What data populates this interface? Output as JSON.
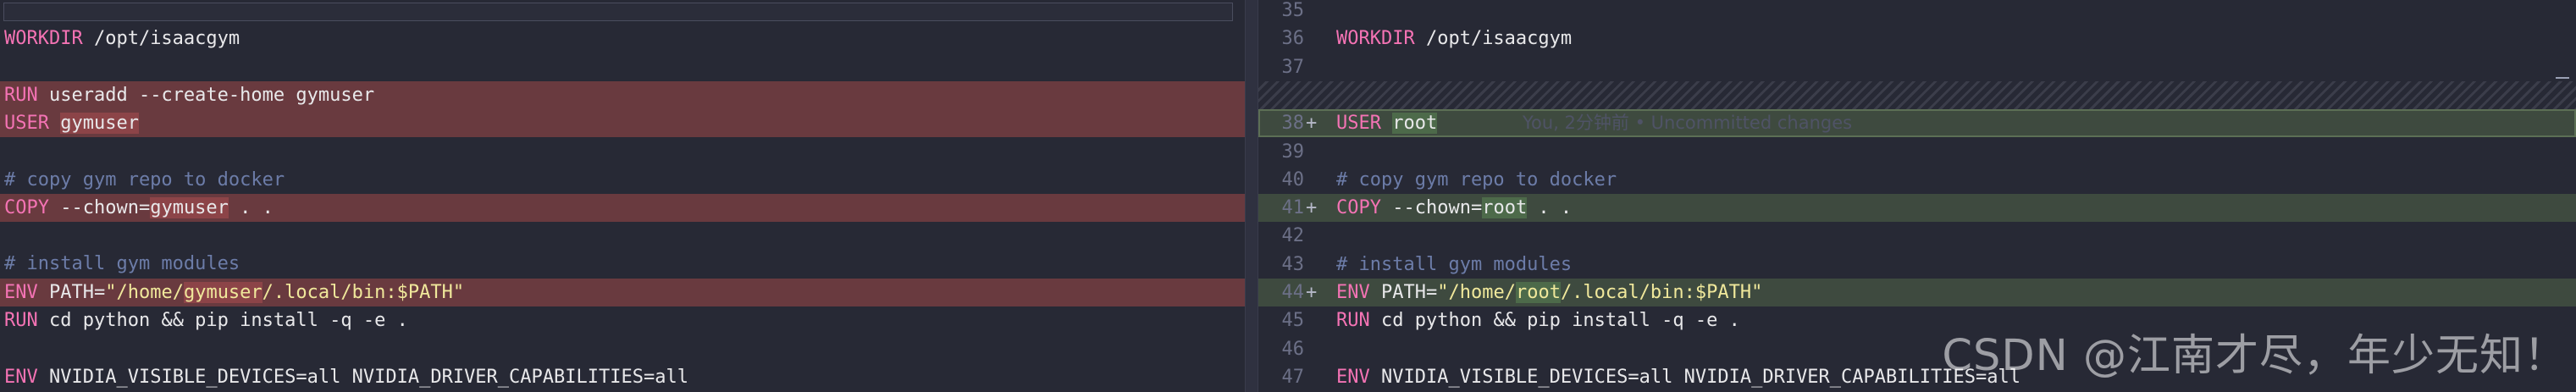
{
  "left_pane": {
    "lines": [
      {
        "type": "normal",
        "segments": [
          {
            "cls": "kw",
            "text": "WORKDIR"
          },
          {
            "cls": "",
            "text": " /opt/isaacgym"
          }
        ]
      },
      {
        "type": "empty",
        "segments": []
      },
      {
        "type": "del",
        "segments": [
          {
            "cls": "kw",
            "text": "RUN"
          },
          {
            "cls": "",
            "text": " useradd --create-home gymuser"
          }
        ]
      },
      {
        "type": "del",
        "segments": [
          {
            "cls": "kw",
            "text": "USER"
          },
          {
            "cls": "",
            "text": " "
          },
          {
            "cls": "hl",
            "text": "gymuser"
          }
        ]
      },
      {
        "type": "empty",
        "segments": []
      },
      {
        "type": "normal",
        "segments": [
          {
            "cls": "cmt",
            "text": "# copy gym repo to docker"
          }
        ]
      },
      {
        "type": "del",
        "segments": [
          {
            "cls": "kw",
            "text": "COPY"
          },
          {
            "cls": "",
            "text": " --chown="
          },
          {
            "cls": "hl",
            "text": "gymuser"
          },
          {
            "cls": "",
            "text": " . ."
          }
        ]
      },
      {
        "type": "empty",
        "segments": []
      },
      {
        "type": "normal",
        "segments": [
          {
            "cls": "cmt",
            "text": "# install gym modules"
          }
        ]
      },
      {
        "type": "del",
        "segments": [
          {
            "cls": "kw",
            "text": "ENV"
          },
          {
            "cls": "",
            "text": " PATH="
          },
          {
            "cls": "str",
            "text": "\"/home/"
          },
          {
            "cls": "str hl",
            "text": "gymuser"
          },
          {
            "cls": "str",
            "text": "/.local/bin:$PATH\""
          }
        ]
      },
      {
        "type": "normal",
        "segments": [
          {
            "cls": "kw",
            "text": "RUN"
          },
          {
            "cls": "",
            "text": " cd python && pip install -q -e ."
          }
        ]
      },
      {
        "type": "empty",
        "segments": []
      },
      {
        "type": "normal",
        "segments": [
          {
            "cls": "kw",
            "text": "ENV"
          },
          {
            "cls": "",
            "text": " NVIDIA_VISIBLE_DEVICES=all NVIDIA_DRIVER_CAPABILITIES=all"
          }
        ]
      }
    ]
  },
  "right_pane": {
    "lines": [
      {
        "num": "35",
        "marker": "",
        "type": "empty",
        "segments": []
      },
      {
        "num": "36",
        "marker": "",
        "type": "normal",
        "segments": [
          {
            "cls": "kw",
            "text": "WORKDIR"
          },
          {
            "cls": "",
            "text": " /opt/isaacgym"
          }
        ]
      },
      {
        "num": "37",
        "marker": "",
        "type": "empty",
        "segments": []
      },
      {
        "num": "",
        "marker": "",
        "type": "hatch",
        "segments": []
      },
      {
        "num": "38",
        "marker": "+",
        "type": "add current",
        "segments": [
          {
            "cls": "kw",
            "text": "USER"
          },
          {
            "cls": "",
            "text": " "
          },
          {
            "cls": "hl",
            "text": "root"
          }
        ],
        "blame": "You, 2分钟前 • Uncommitted changes"
      },
      {
        "num": "39",
        "marker": "",
        "type": "empty",
        "segments": []
      },
      {
        "num": "40",
        "marker": "",
        "type": "normal",
        "segments": [
          {
            "cls": "cmt",
            "text": "# copy gym repo to docker"
          }
        ]
      },
      {
        "num": "41",
        "marker": "+",
        "type": "add",
        "segments": [
          {
            "cls": "kw",
            "text": "COPY"
          },
          {
            "cls": "",
            "text": " --chown="
          },
          {
            "cls": "hl",
            "text": "root"
          },
          {
            "cls": "",
            "text": " . ."
          }
        ]
      },
      {
        "num": "42",
        "marker": "",
        "type": "empty",
        "segments": []
      },
      {
        "num": "43",
        "marker": "",
        "type": "normal",
        "segments": [
          {
            "cls": "cmt",
            "text": "# install gym modules"
          }
        ]
      },
      {
        "num": "44",
        "marker": "+",
        "type": "add",
        "segments": [
          {
            "cls": "kw",
            "text": "ENV"
          },
          {
            "cls": "",
            "text": " PATH="
          },
          {
            "cls": "str",
            "text": "\"/home/"
          },
          {
            "cls": "str hl",
            "text": "root"
          },
          {
            "cls": "str",
            "text": "/.local/bin:$PATH\""
          }
        ]
      },
      {
        "num": "45",
        "marker": "",
        "type": "normal",
        "segments": [
          {
            "cls": "kw",
            "text": "RUN"
          },
          {
            "cls": "",
            "text": " cd python && pip install -q -e ."
          }
        ]
      },
      {
        "num": "46",
        "marker": "",
        "type": "empty",
        "segments": []
      },
      {
        "num": "47",
        "marker": "",
        "type": "normal",
        "segments": [
          {
            "cls": "kw",
            "text": "ENV"
          },
          {
            "cls": "",
            "text": " NVIDIA_VISIBLE_DEVICES=all NVIDIA_DRIVER_CAPABILITIES=all"
          }
        ]
      }
    ]
  },
  "watermark": "CSDN @江南才尽，年少无知！",
  "colors": {
    "background": "#272935",
    "keyword": "#f473b4",
    "string": "#f0e89b",
    "comment": "#6c7ca8",
    "deleted_line": "#693a3f",
    "added_line": "#3e4a3f"
  }
}
